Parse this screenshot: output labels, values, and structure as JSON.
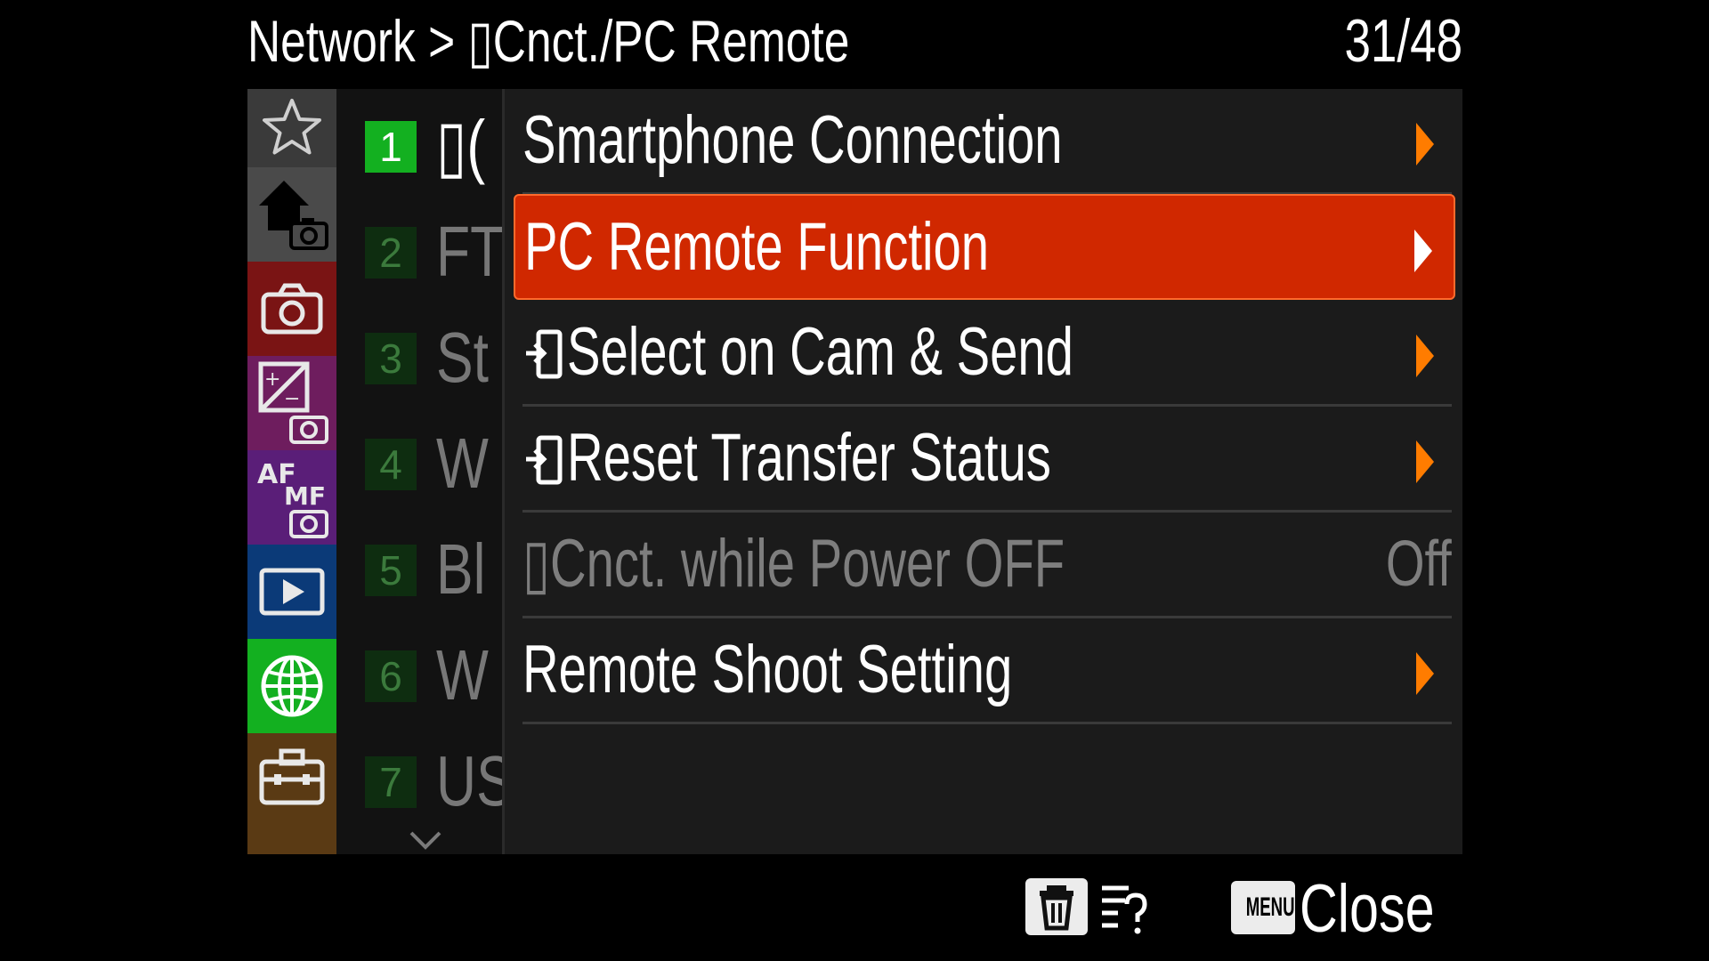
{
  "header": {
    "breadcrumb": "Network > ▯Cnct./PC Remote",
    "page_indicator": "31/48"
  },
  "sidebar": {
    "categories": [
      {
        "icon": "star-icon",
        "color": "#3a3a3a"
      },
      {
        "icon": "home-camera-icon",
        "color": "#4a4a4a"
      },
      {
        "icon": "camera-icon",
        "color": "#7a1414"
      },
      {
        "icon": "exposure-camera-icon",
        "color": "#6e1d5e"
      },
      {
        "icon": "af-mf-camera-icon",
        "color": "#5a1e78"
      },
      {
        "icon": "playback-icon",
        "color": "#0b3a78"
      },
      {
        "icon": "globe-icon",
        "color": "#13b020",
        "selected": true
      },
      {
        "icon": "toolbox-icon",
        "color": "#5a3a14"
      }
    ]
  },
  "pages": {
    "items": [
      {
        "number": "1",
        "title": "▯(",
        "active": true
      },
      {
        "number": "2",
        "title": "FT"
      },
      {
        "number": "3",
        "title": "St"
      },
      {
        "number": "4",
        "title": "W"
      },
      {
        "number": "5",
        "title": "Bl"
      },
      {
        "number": "6",
        "title": "W"
      },
      {
        "number": "7",
        "title": "US"
      }
    ],
    "more_icon": "chevron-down-icon"
  },
  "menu": {
    "items": [
      {
        "label": "Smartphone Connection",
        "type": "submenu"
      },
      {
        "label": "PC Remote Function",
        "type": "submenu",
        "selected": true
      },
      {
        "label": "Select on Cam & Send",
        "type": "submenu",
        "icon": "transfer-icon"
      },
      {
        "label": "Reset Transfer Status",
        "type": "submenu",
        "icon": "transfer-icon"
      },
      {
        "label": "▯Cnct. while Power OFF",
        "type": "value",
        "value": "Off",
        "disabled": true
      },
      {
        "label": "Remote Shoot Setting",
        "type": "submenu"
      }
    ]
  },
  "footer": {
    "delete_icon": "trash-icon",
    "help_icon": "help-list-icon",
    "menu_key": "MENU",
    "close_label": "Close"
  },
  "colors": {
    "accent_selected": "#d02800",
    "arrow": "#ff7c00",
    "active_green": "#13b020"
  }
}
